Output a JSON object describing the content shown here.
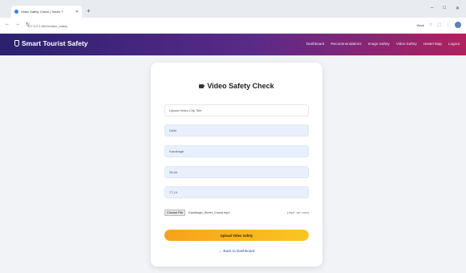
{
  "browser": {
    "tab_title": "Video Safety Check | Smart T",
    "url": "127.0.0.1:5000/video_safety",
    "profile_label": "Work"
  },
  "site": {
    "brand": "Smart Tourist Safety",
    "nav": [
      "Dashboard",
      "Recommendations",
      "Image Safety",
      "Video Safety",
      "Hostel Map",
      "Logout"
    ]
  },
  "card": {
    "title": "Video Safety Check",
    "fields": [
      {
        "value": "",
        "placeholder": "Upload Video Clip Title"
      },
      {
        "value": "Delhi",
        "placeholder": ""
      },
      {
        "value": "Karolbagh",
        "placeholder": ""
      },
      {
        "value": "28.65",
        "placeholder": ""
      },
      {
        "value": "77.19",
        "placeholder": ""
      }
    ],
    "file": {
      "button": "Choose File",
      "filename": "Karolbagh_Street_Crowd.mp4",
      "hint": "(.mp4 .avi .mov)"
    },
    "upload_button": "Upload Video Safety",
    "back_link": "← Back to Dashboard"
  },
  "colors": {
    "nav_gradient_start": "#2a2170",
    "nav_gradient_end": "#b0215e",
    "button_start": "#f7a21b",
    "button_end": "#f9c623",
    "field_fill": "#e8f0fe"
  }
}
